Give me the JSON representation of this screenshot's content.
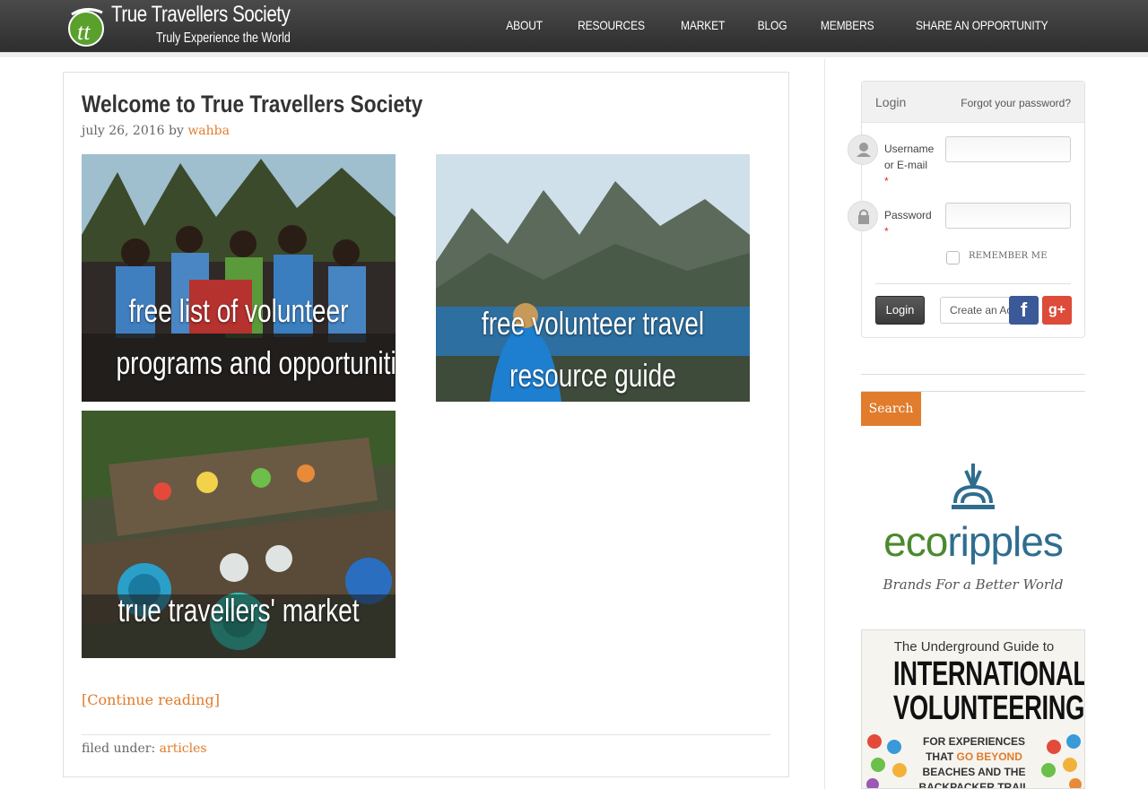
{
  "site": {
    "name": "True Travellers Society",
    "tagline": "Truly Experience the World",
    "logo_mark": "tt"
  },
  "nav": [
    "ABOUT",
    "RESOURCES",
    "MARKET",
    "BLOG",
    "MEMBERS",
    "SHARE AN OPPORTUNITY"
  ],
  "post": {
    "title": "Welcome to True Travellers Society",
    "date": "july 26, 2016",
    "by": "by",
    "author": "wahba",
    "tiles": [
      {
        "line1": "free list of volunteer",
        "line2": "programs and opportunities"
      },
      {
        "line1": "free volunteer travel",
        "line2": "resource guide"
      },
      {
        "line1": "true travellers' market"
      }
    ],
    "continue": "[Continue reading]",
    "filed_label": "filed under:",
    "category": "articles"
  },
  "login": {
    "tab": "Login",
    "forgot": "Forgot your password?",
    "username_label": "Username or E-mail",
    "password_label": "Password",
    "required": "*",
    "remember": "REMEMBER ME",
    "login_btn": "Login",
    "create_btn": "Create an Account",
    "facebook": "f",
    "google": "g+"
  },
  "search": {
    "button": "Search"
  },
  "ads": {
    "eco_part1": "eco",
    "eco_part2": "ripples",
    "eco_tagline": "Brands For a Better World",
    "book_top": "The Underground Guide to",
    "book_title1": "INTERNATIONAL",
    "book_title2": "VOLUNTEERING",
    "book_sub1": "FOR EXPERIENCES",
    "book_sub2_a": "THAT",
    "book_sub2_b": "GO BEYOND",
    "book_sub3": "BEACHES AND THE",
    "book_sub4": "BACKPACKER TRAIL"
  },
  "colors": {
    "accent": "#e07c2c",
    "header": "#3a3a3a",
    "facebook": "#3b5998",
    "google": "#dd4b39"
  }
}
